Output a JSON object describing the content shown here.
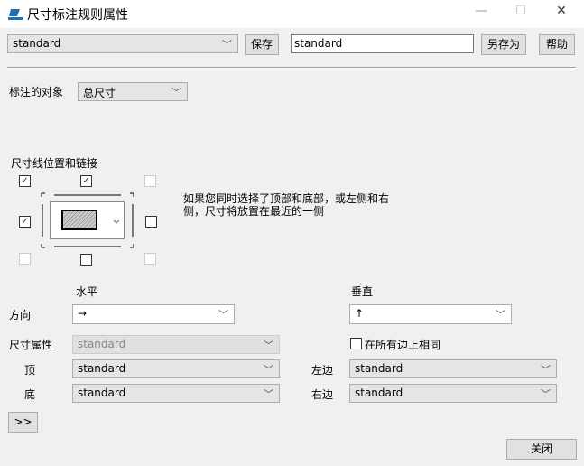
{
  "window": {
    "title": "尺寸标注规则属性",
    "minimize": "—",
    "maximize": "☐",
    "close": "✕"
  },
  "toolbar": {
    "rule_select": "standard",
    "save": "保存",
    "name_input": "standard",
    "save_as": "另存为",
    "help": "帮助"
  },
  "target": {
    "label": "标注的对象",
    "value": "总尺寸"
  },
  "position": {
    "label": "尺寸线位置和链接",
    "note": "如果您同时选择了顶部和底部，或左侧和右侧，尺寸将放置在最近的一侧",
    "checked_mark": "✓"
  },
  "direction": {
    "label": "方向",
    "horizontal_label": "水平",
    "vertical_label": "垂直",
    "horizontal_value": "→",
    "vertical_value": "↑"
  },
  "attributes": {
    "label": "尺寸属性",
    "value": "standard",
    "same_all": "在所有边上相同",
    "top_label": "顶",
    "top_value": "standard",
    "bottom_label": "底",
    "bottom_value": "standard",
    "left_label": "左边",
    "left_value": "standard",
    "right_label": "右边",
    "right_value": "standard"
  },
  "more": ">>",
  "close": "关闭"
}
